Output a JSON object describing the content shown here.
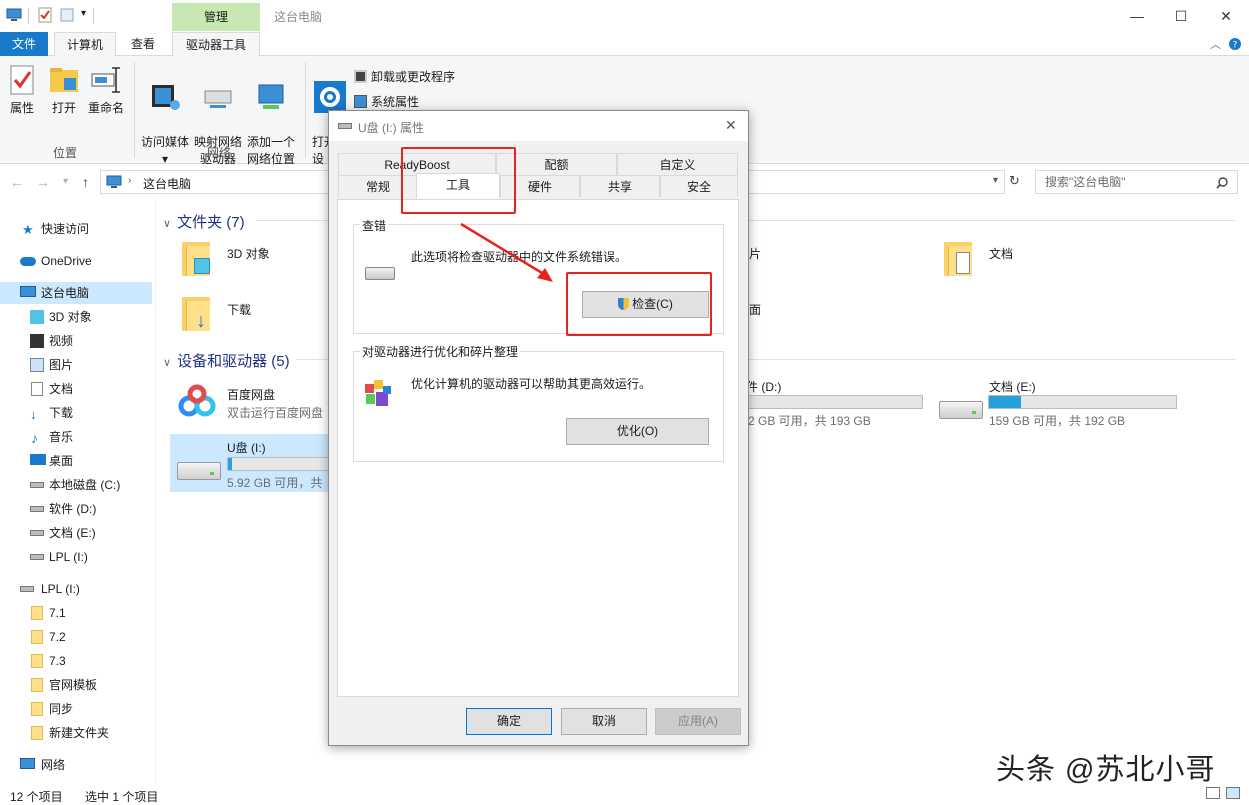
{
  "window": {
    "title": "这台电脑",
    "manage_tab": "管理",
    "controls": {
      "minimize": "—",
      "maximize": "☐",
      "close": "✕"
    }
  },
  "ribbon_tabs": [
    "文件",
    "计算机",
    "查看",
    "驱动器工具"
  ],
  "ribbon": {
    "location": {
      "group": "位置",
      "buttons": [
        "属性",
        "打开",
        "重命名"
      ]
    },
    "network": {
      "group": "网络",
      "buttons": [
        "访问媒体",
        "映射网络\n驱动器",
        "添加一个\n网络位置"
      ]
    },
    "system": {
      "open": "打开\n设",
      "uninstall": "卸载或更改程序",
      "sysprops": "系统属性"
    }
  },
  "address": {
    "path": "这台电脑",
    "search_placeholder": "搜索\"这台电脑\""
  },
  "nav": [
    {
      "label": "快速访问",
      "icon": "star-icon"
    },
    {
      "label": "OneDrive",
      "icon": "cloud-icon"
    },
    {
      "label": "这台电脑",
      "icon": "computer-icon",
      "selected": true
    },
    {
      "label": "3D 对象",
      "icon": "cube-icon"
    },
    {
      "label": "视频",
      "icon": "video-icon"
    },
    {
      "label": "图片",
      "icon": "picture-icon"
    },
    {
      "label": "文档",
      "icon": "document-icon"
    },
    {
      "label": "下载",
      "icon": "download-icon"
    },
    {
      "label": "音乐",
      "icon": "music-icon"
    },
    {
      "label": "桌面",
      "icon": "desktop-icon"
    },
    {
      "label": "本地磁盘 (C:)",
      "icon": "drive-icon"
    },
    {
      "label": "软件 (D:)",
      "icon": "drive-icon"
    },
    {
      "label": "文档 (E:)",
      "icon": "drive-icon"
    },
    {
      "label": "LPL (I:)",
      "icon": "drive-icon"
    },
    {
      "label": "LPL (I:)",
      "icon": "drive-icon"
    },
    {
      "label": "7.1",
      "icon": "folder-icon"
    },
    {
      "label": "7.2",
      "icon": "folder-icon"
    },
    {
      "label": "7.3",
      "icon": "folder-icon"
    },
    {
      "label": "官网模板",
      "icon": "folder-icon"
    },
    {
      "label": "同步",
      "icon": "folder-icon"
    },
    {
      "label": "新建文件夹",
      "icon": "folder-icon"
    },
    {
      "label": "网络",
      "icon": "network-icon"
    }
  ],
  "content": {
    "folders_header": "文件夹 (7)",
    "folders": [
      "3D 对象",
      "下载",
      "片",
      "面",
      "文档"
    ],
    "drives_header": "设备和驱动器 (5)",
    "baidu": {
      "name": "百度网盘",
      "sub": "双击运行百度网盘"
    },
    "usb": {
      "name": "U盘 (I:)",
      "free": "5.92 GB 可用，共",
      "used_fraction": 0.04
    },
    "drive_d": {
      "name": "件 (D:)",
      "free": "2 GB 可用，共 193 GB",
      "used_fraction": 0.0
    },
    "drive_e": {
      "name": "文档 (E:)",
      "free": "159 GB 可用，共 192 GB",
      "used_fraction": 0.17
    }
  },
  "status": {
    "count": "12 个项目",
    "selected": "选中 1 个项目"
  },
  "dialog": {
    "title": "U盘 (I:) 属性",
    "tabs_top": [
      "ReadyBoost",
      "配额",
      "自定义"
    ],
    "tabs_bottom": [
      "常规",
      "工具",
      "硬件",
      "共享",
      "安全"
    ],
    "active_tab": "工具",
    "check": {
      "group": "查错",
      "desc": "此选项将检查驱动器中的文件系统错误。",
      "button": "检查(C)"
    },
    "optimize": {
      "group": "对驱动器进行优化和碎片整理",
      "desc": "优化计算机的驱动器可以帮助其更高效运行。",
      "button": "优化(O)"
    },
    "buttons": {
      "ok": "确定",
      "cancel": "取消",
      "apply": "应用(A)"
    }
  },
  "watermark": "头条 @苏北小哥",
  "colors": {
    "accent": "#1979ca",
    "selection": "#cce8ff",
    "manage_tab": "#c7e8b3",
    "annotation": "#e8231b",
    "progress": "#26a0da"
  }
}
